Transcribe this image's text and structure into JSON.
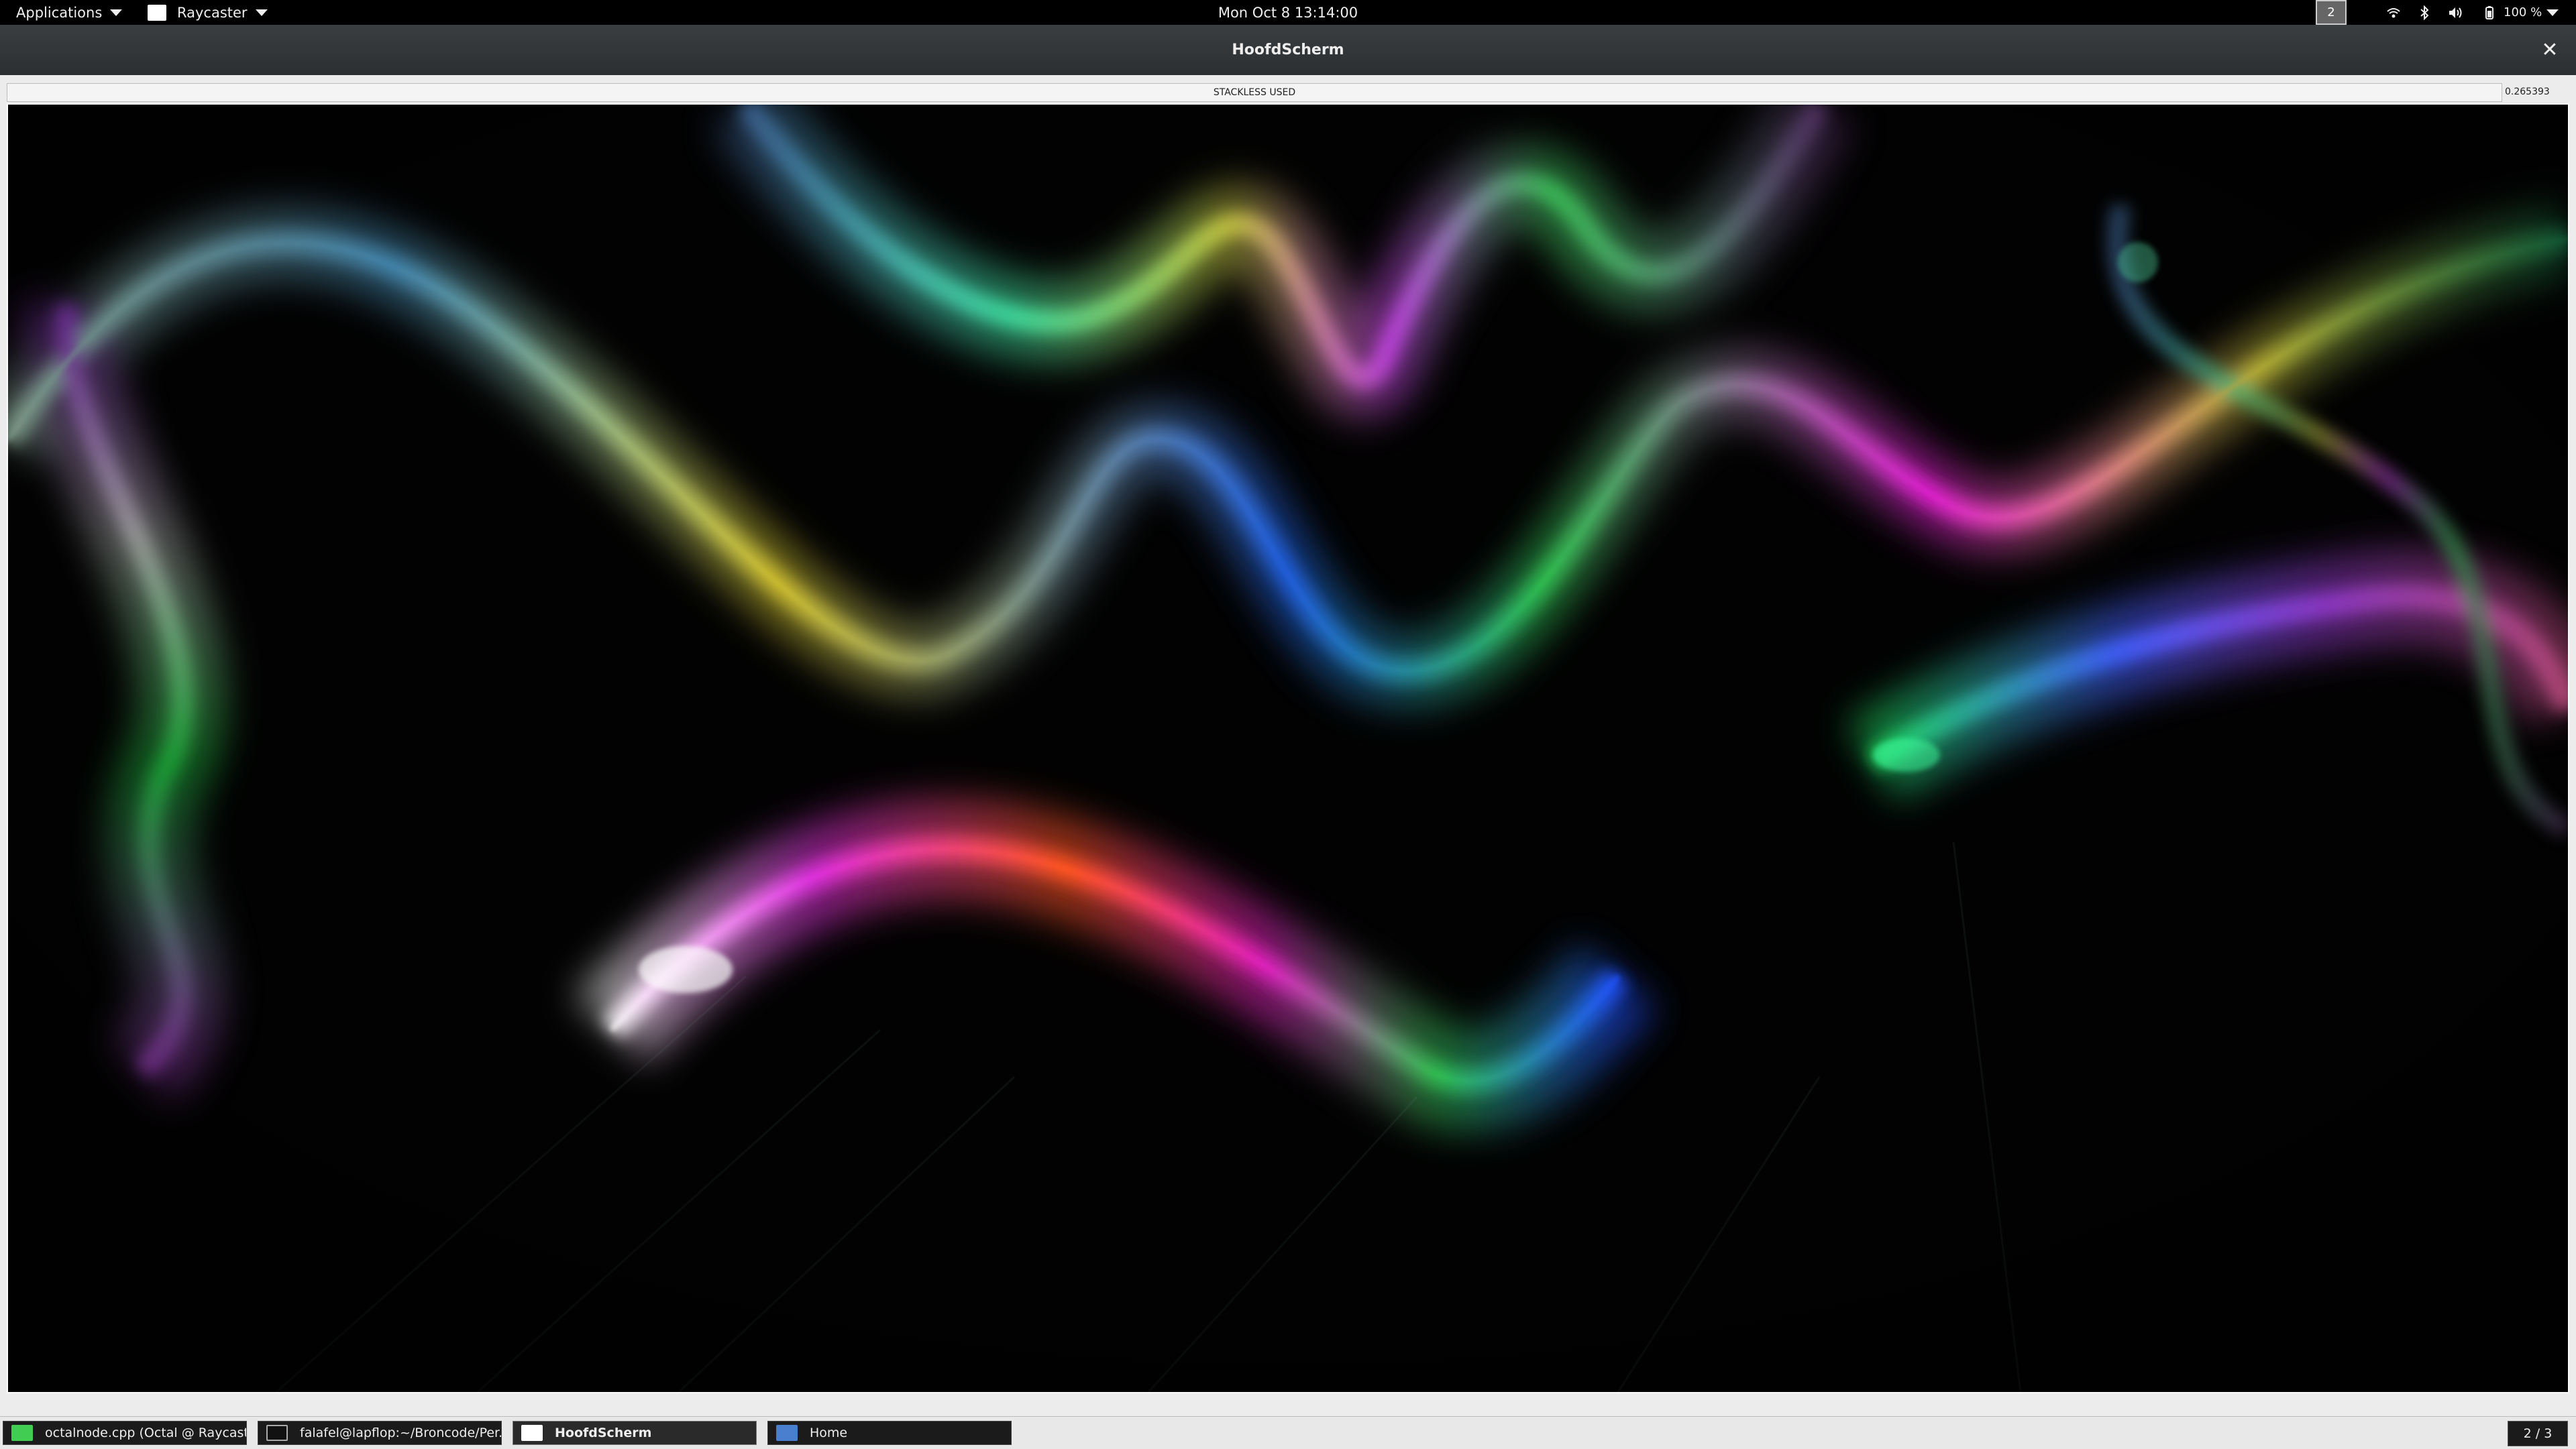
{
  "topbar": {
    "applications_label": "Applications",
    "app_menu_label": "Raycaster",
    "clock": "Mon Oct 8  13:14:00",
    "workspace_number": "2",
    "battery_percent": "100 %"
  },
  "window": {
    "title": "HoofdScherm",
    "close_symbol": "✕"
  },
  "status": {
    "label": "STACKLESS USED",
    "value": "0.265393"
  },
  "taskbar": {
    "tasks": [
      {
        "label": "octalnode.cpp (Octal @ Raycaste...",
        "icon": "qt-creator-icon"
      },
      {
        "label": "falafel@lapflop:~/Broncode/Per...",
        "icon": "terminal-icon"
      },
      {
        "label": "HoofdScherm",
        "icon": "window-icon"
      },
      {
        "label": "Home",
        "icon": "folder-icon"
      }
    ],
    "pager": "2 / 3"
  },
  "colors": {
    "topbar_bg": "#000000",
    "titlebar_bg": "#2f3335",
    "render_bg": "#020202",
    "taskbar_bg": "#e8e8e8"
  }
}
